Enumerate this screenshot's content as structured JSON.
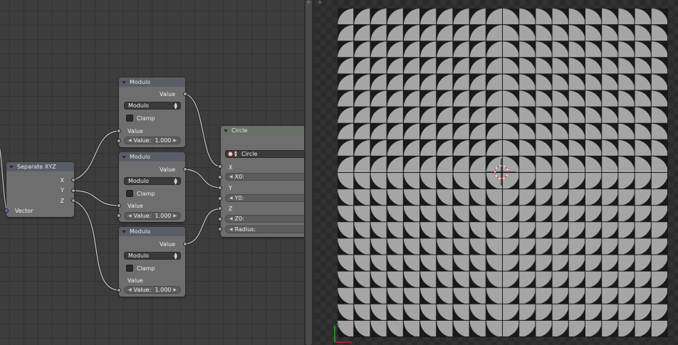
{
  "node_editor": {
    "separate_xyz": {
      "title": "Separate XYZ",
      "outputs": [
        "X",
        "Y",
        "Z"
      ],
      "input": "Vector"
    },
    "modulo_nodes": [
      {
        "title": "Modulo",
        "output": "Value",
        "operation": "Modulo",
        "clamp_label": "Clamp",
        "input_label": "Value",
        "field_label": "Value:",
        "field_value": "1.000"
      },
      {
        "title": "Modulo",
        "output": "Value",
        "operation": "Modulo",
        "clamp_label": "Clamp",
        "input_label": "Value",
        "field_label": "Value:",
        "field_value": "1.000"
      },
      {
        "title": "Modulo",
        "output": "Value",
        "operation": "Modulo",
        "clamp_label": "Clamp",
        "input_label": "Value",
        "field_label": "Value:",
        "field_value": "1.000"
      }
    ],
    "circle": {
      "title": "Circle",
      "shape_select": "Circle",
      "rows": [
        "X",
        "X0:",
        "Y",
        "Y0:",
        "Z",
        "Z0:",
        "Radius:"
      ]
    }
  },
  "viewer": {
    "cursor_icon": "crosshair-cursor-icon",
    "axis_icon": "xy-axis-gizmo-icon",
    "corner_glyph": "+"
  },
  "colors": {
    "image_gray": "#a5a5a5",
    "image_black": "#1a1a1a",
    "wire": "#bdbdbd",
    "vector_socket": "#6464c7"
  }
}
